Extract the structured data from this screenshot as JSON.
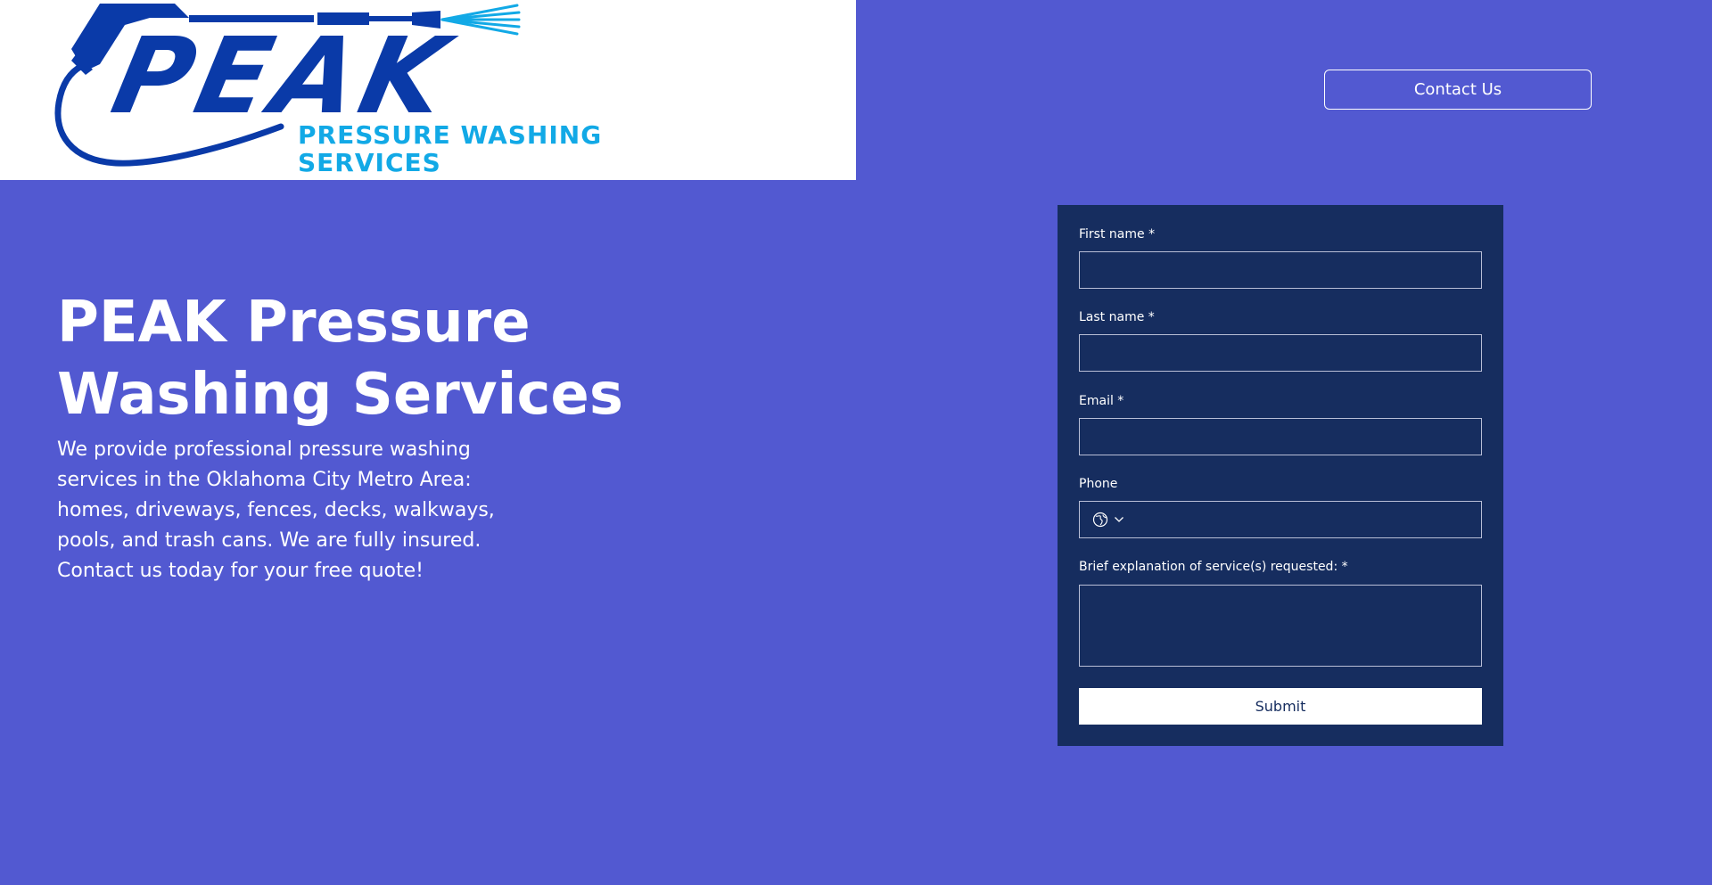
{
  "logo": {
    "word": "PEAK",
    "subtitle_line1": "PRESSURE WASHING",
    "subtitle_line2": "SERVICES"
  },
  "header": {
    "contact_label": "Contact Us"
  },
  "hero": {
    "title": "PEAK Pressure Washing Services",
    "description": "We provide professional pressure washing services in the Oklahoma City Metro Area: homes, driveways, fences, decks, walkways, pools, and trash cans. We are fully insured. Contact us today for your free quote!"
  },
  "form": {
    "first_name_label": "First name *",
    "first_name_value": "",
    "last_name_label": "Last name *",
    "last_name_value": "",
    "email_label": "Email *",
    "email_value": "",
    "phone_label": "Phone",
    "phone_value": "",
    "service_label": "Brief explanation of service(s) requested: *",
    "service_value": "",
    "submit_label": "Submit"
  },
  "colors": {
    "background": "#5259d1",
    "form_background": "#162d5f",
    "logo_dark_blue": "#0a3aa8",
    "logo_light_blue": "#12a9e6"
  },
  "icons": {
    "country": "globe-icon",
    "dropdown": "chevron-down-icon"
  }
}
